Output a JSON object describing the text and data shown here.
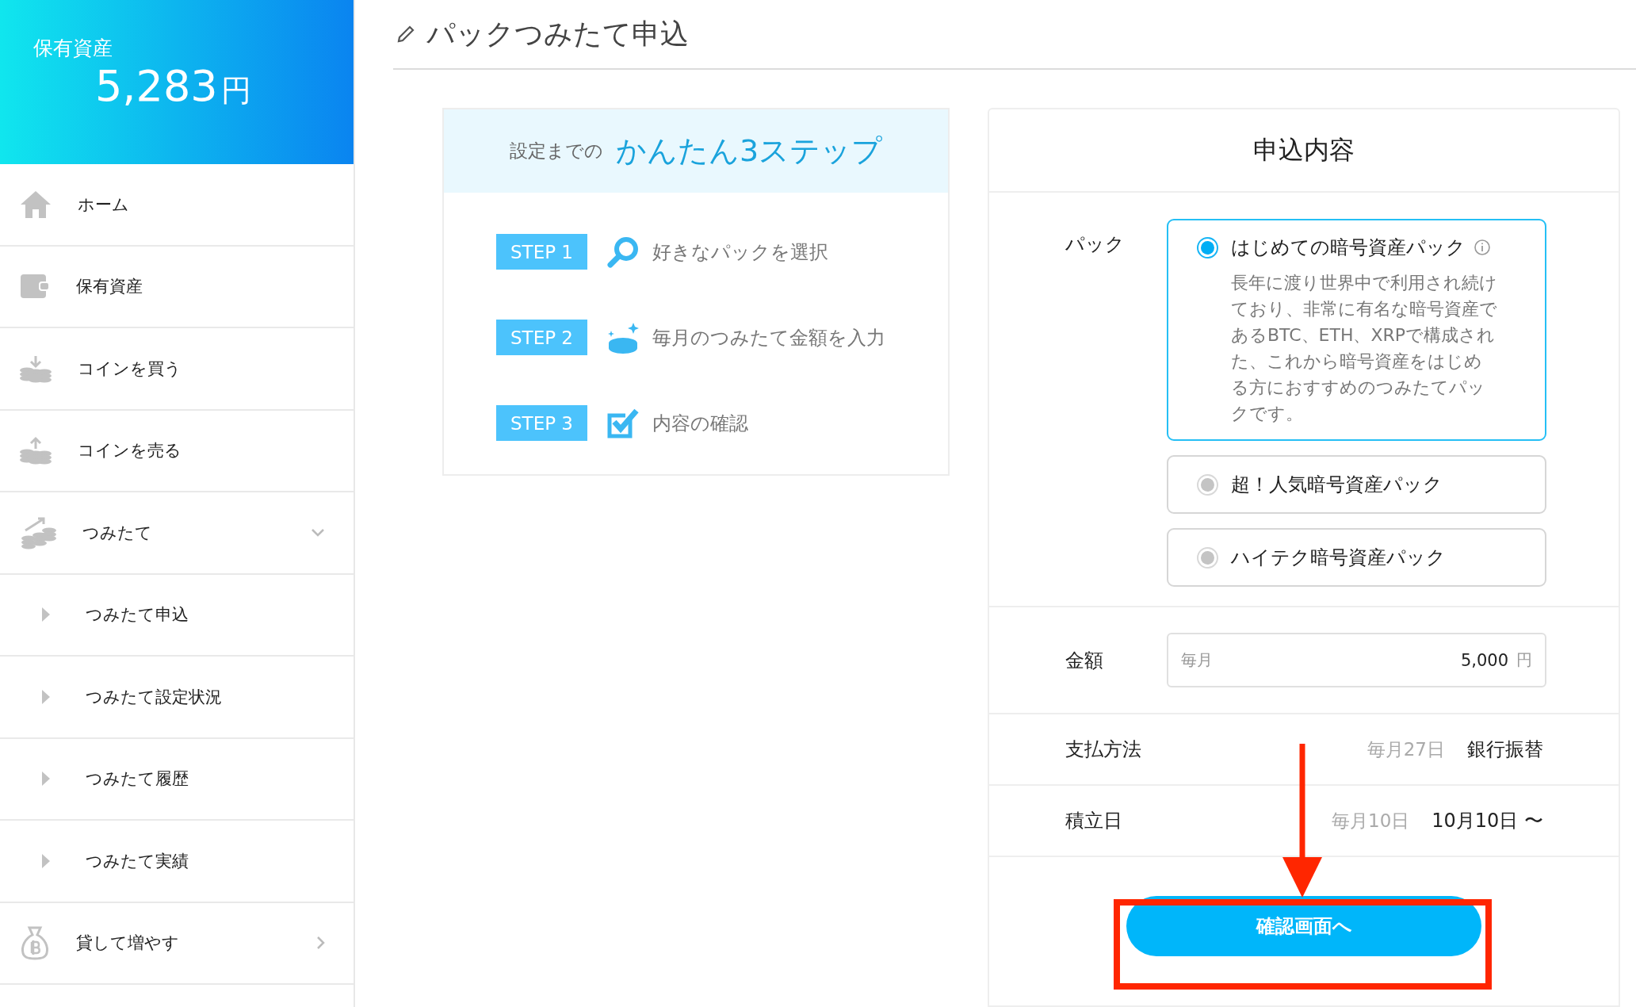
{
  "sidebar": {
    "balance": {
      "label": "保有資産",
      "amount": "5,283",
      "unit": "円"
    },
    "items": [
      {
        "label": "ホーム"
      },
      {
        "label": "保有資産"
      },
      {
        "label": "コインを買う"
      },
      {
        "label": "コインを売る"
      },
      {
        "label": "つみたて",
        "expanded": true,
        "children": [
          {
            "label": "つみたて申込"
          },
          {
            "label": "つみたて設定状況"
          },
          {
            "label": "つみたて履歴"
          },
          {
            "label": "つみたて実績"
          }
        ]
      },
      {
        "label": "貸して増やす",
        "expanded": false
      }
    ]
  },
  "page_title": "パックつみたて申込",
  "steps_card": {
    "lead": "設定までの",
    "headline": "かんたん3ステップ",
    "steps": [
      {
        "badge": "STEP 1",
        "text": "好きなパックを選択"
      },
      {
        "badge": "STEP 2",
        "text": "毎月のつみたて金額を入力"
      },
      {
        "badge": "STEP 3",
        "text": "内容の確認"
      }
    ]
  },
  "form": {
    "title": "申込内容",
    "pack": {
      "label": "パック",
      "options": [
        {
          "name": "はじめての暗号資産パック",
          "selected": true,
          "info_icon": true,
          "description": "長年に渡り世界中で利用され続けており、非常に有名な暗号資産であるBTC、ETH、XRPで構成された、これから暗号資産をはじめる方におすすめのつみたてパックです。"
        },
        {
          "name": "超！人気暗号資産パック",
          "selected": false,
          "info_icon": false
        },
        {
          "name": "ハイテク暗号資産パック",
          "selected": false,
          "info_icon": false
        }
      ]
    },
    "amount": {
      "label": "金額",
      "prefix": "毎月",
      "value": "5,000",
      "unit": "円"
    },
    "rows": [
      {
        "label": "支払方法",
        "note": "毎月27日",
        "value": "銀行振替"
      },
      {
        "label": "積立日",
        "note": "毎月10日",
        "value": "10月10日 〜"
      }
    ],
    "submit": "確認画面へ"
  }
}
